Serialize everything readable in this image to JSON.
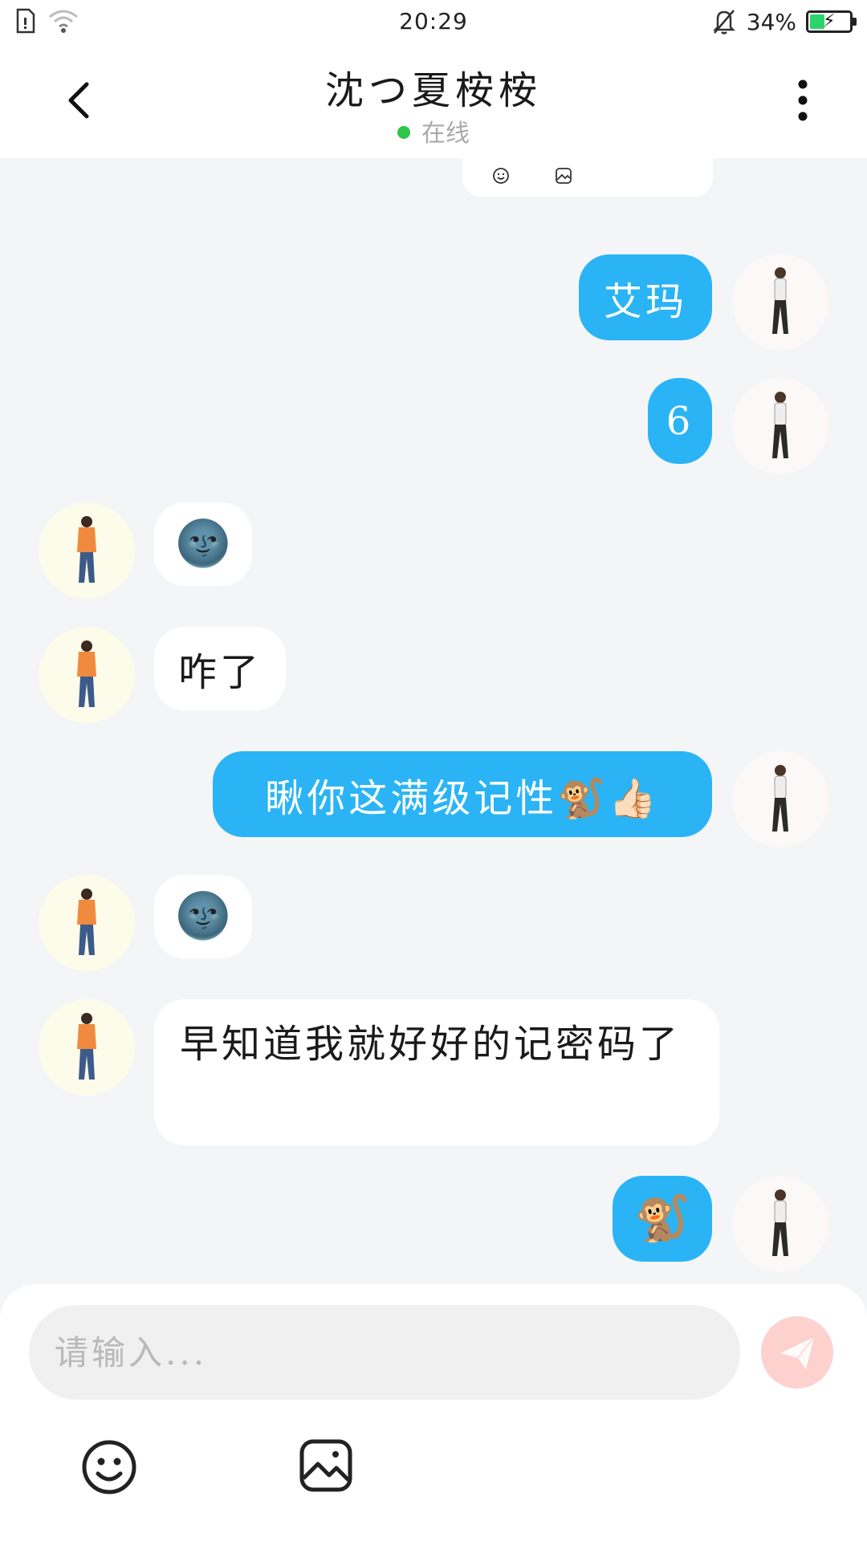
{
  "status_bar": {
    "time": "20:29",
    "battery_text": "34%",
    "battery_level": 0.34,
    "icons": [
      "sim-card-icon",
      "wifi-icon",
      "bell-muted-icon",
      "battery-icon"
    ]
  },
  "header": {
    "title": "沈つ夏桉桉",
    "status_text": "在线",
    "status_color": "#2fc549",
    "back_icon": "chevron-left-icon",
    "more_icon": "more-vertical-icon"
  },
  "colors": {
    "my_bubble": "#2ab4f5",
    "their_bubble": "#ffffff",
    "background": "#f4f5f7",
    "send_button": "#fb7d74",
    "battery_fill": "#2bd46b"
  },
  "messages": [
    {
      "from": "me",
      "text": "艾玛"
    },
    {
      "from": "me",
      "text": "6"
    },
    {
      "from": "them",
      "text": "🌚"
    },
    {
      "from": "them",
      "text": "咋了"
    },
    {
      "from": "me",
      "text": "瞅你这满级记性🐒👍🏻"
    },
    {
      "from": "them",
      "text": "🌚"
    },
    {
      "from": "them",
      "text": "早知道我就好好的记密码了"
    },
    {
      "from": "me",
      "text": "🐒"
    }
  ],
  "input": {
    "placeholder": "请输入...",
    "value": ""
  },
  "toolbar": {
    "emoji_icon": "smiley-icon",
    "image_icon": "image-icon",
    "send_icon": "paper-plane-icon"
  }
}
